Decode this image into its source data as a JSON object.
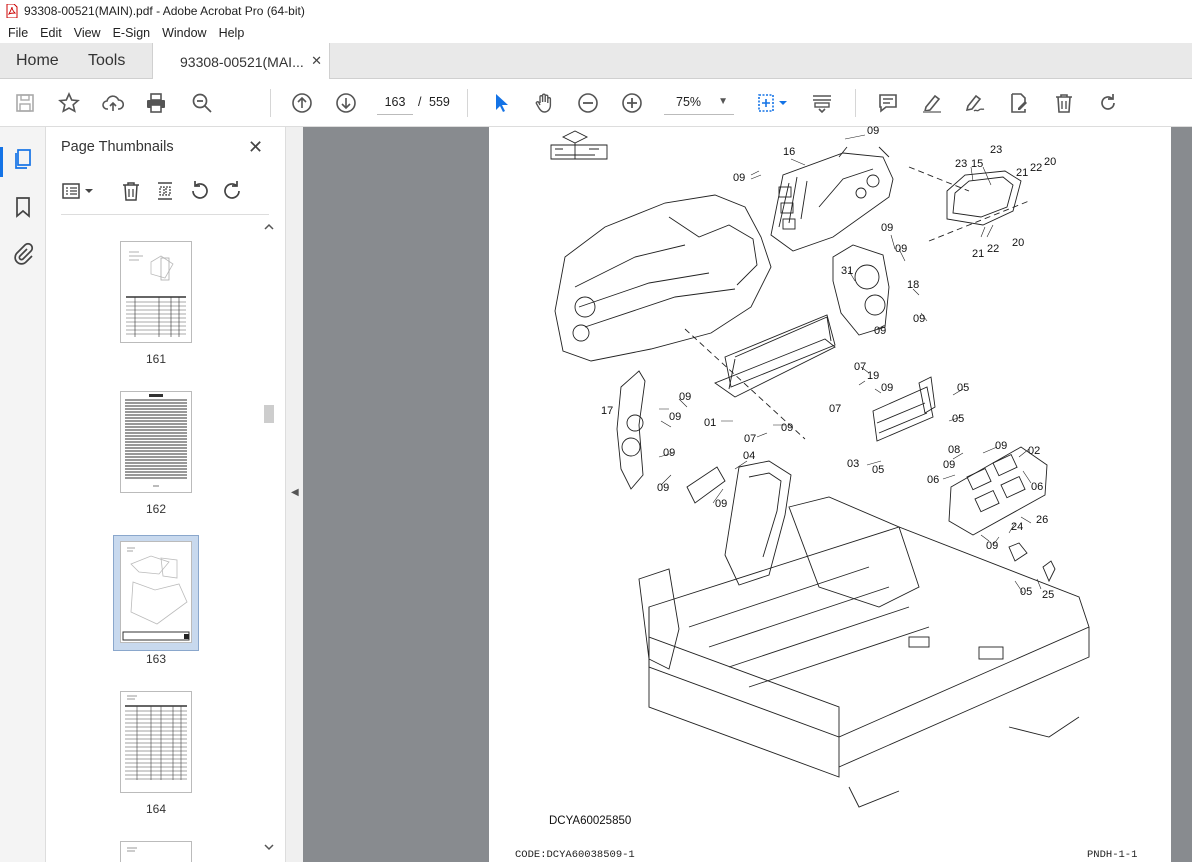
{
  "window": {
    "title": "93308-00521(MAIN).pdf - Adobe Acrobat Pro (64-bit)"
  },
  "menu": [
    "File",
    "Edit",
    "View",
    "E-Sign",
    "Window",
    "Help"
  ],
  "tabs": {
    "home": "Home",
    "tools": "Tools",
    "doc": "93308-00521(MAI..."
  },
  "toolbar": {
    "current_page": "163",
    "separator": "/",
    "total_pages": "559",
    "zoom": "75%"
  },
  "panel": {
    "title": "Page Thumbnails",
    "thumbnails": [
      "161",
      "162",
      "163",
      "164"
    ],
    "selected": "163"
  },
  "page": {
    "callouts": [
      "09",
      "16",
      "09",
      "23",
      "15",
      "23",
      "21",
      "22",
      "20",
      "09",
      "09",
      "31",
      "21",
      "22",
      "20",
      "18",
      "09",
      "09",
      "07",
      "19",
      "09",
      "05",
      "17",
      "09",
      "09",
      "01",
      "07",
      "09",
      "07",
      "05",
      "09",
      "03",
      "05",
      "08",
      "09",
      "02",
      "09",
      "04",
      "06",
      "06",
      "09",
      "09",
      "24",
      "26",
      "09",
      "05",
      "25"
    ],
    "drawing_code": "DCYA60025850",
    "footer_left": "CODE:DCYA60038509-1",
    "footer_right": "PNDH-1-1"
  },
  "colors": {
    "accent": "#1473e6",
    "viewer_bg": "#888b8f"
  }
}
